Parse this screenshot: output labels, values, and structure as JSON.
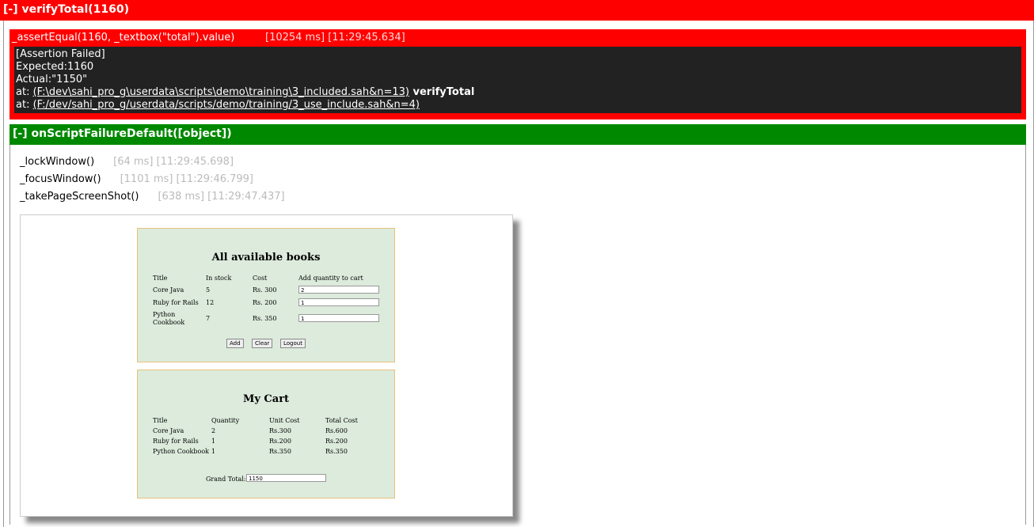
{
  "header": {
    "title": "[-] verifyTotal(1160)"
  },
  "assertion": {
    "command": "_assertEqual(1160, _textbox(\"total\").value)",
    "timing": "[10254 ms] [11:29:45.634]",
    "lines": {
      "l1": "[Assertion Failed]",
      "l2": "Expected:1160",
      "l3": "Actual:\"1150\"",
      "at_prefix": "at: ",
      "link1": "(F:\\dev\\sahi_pro_g\\userdata\\scripts\\demo\\training\\3_included.sah&n=13)",
      "fn1": " verifyTotal",
      "link2": "(F:/dev/sahi_pro_g/userdata/scripts/demo/training/3_use_include.sah&n=4)"
    }
  },
  "group": {
    "title": "[-] onScriptFailureDefault([object])"
  },
  "steps": [
    {
      "cmd": "_lockWindow()",
      "time": "[64 ms] [11:29:45.698]"
    },
    {
      "cmd": "_focusWindow()",
      "time": "[1101 ms] [11:29:46.799]"
    },
    {
      "cmd": "_takePageScreenShot()",
      "time": "[638 ms] [11:29:47.437]"
    }
  ],
  "screenshot": {
    "books": {
      "title": "All available books",
      "headers": [
        "Title",
        "In stock",
        "Cost",
        "Add quantity to cart"
      ],
      "rows": [
        {
          "title": "Core Java",
          "stock": "5",
          "cost": "Rs. 300",
          "qty": "2"
        },
        {
          "title": "Ruby for Rails",
          "stock": "12",
          "cost": "Rs. 200",
          "qty": "1"
        },
        {
          "title": "Python Cookbook",
          "stock": "7",
          "cost": "Rs. 350",
          "qty": "1"
        }
      ],
      "buttons": {
        "add": "Add",
        "clear": "Clear",
        "logout": "Logout"
      }
    },
    "cart": {
      "title": "My Cart",
      "headers": [
        "Title",
        "Quantity",
        "Unit Cost",
        "Total Cost"
      ],
      "rows": [
        {
          "title": "Core Java",
          "qty": "2",
          "unit": "Rs.300",
          "total": "Rs.600"
        },
        {
          "title": "Ruby for Rails",
          "qty": "1",
          "unit": "Rs.200",
          "total": "Rs.200"
        },
        {
          "title": "Python Cookbook",
          "qty": "1",
          "unit": "Rs.350",
          "total": "Rs.350"
        }
      ],
      "grand_total_label": "Grand Total:",
      "grand_total_value": "1150"
    }
  }
}
